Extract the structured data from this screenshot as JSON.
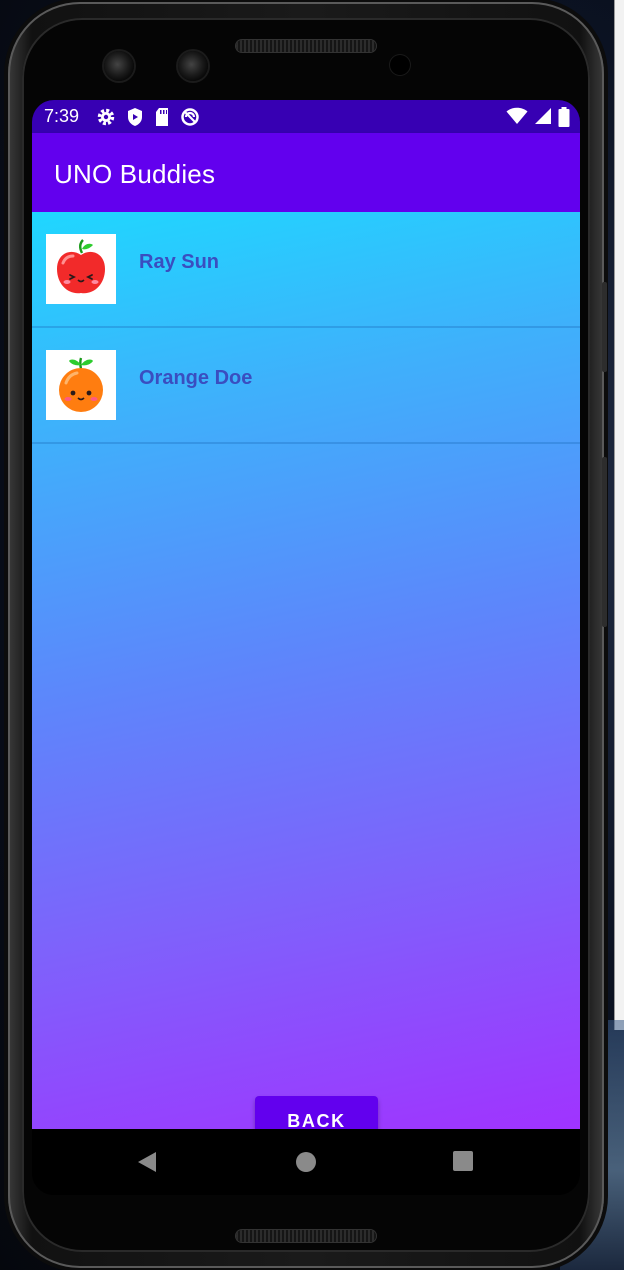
{
  "status_bar": {
    "time": "7:39",
    "left_icons": [
      "gear-icon",
      "shield-icon",
      "sd-card-icon",
      "accessibility-icon"
    ],
    "right_icons": [
      "wifi-icon",
      "signal-icon",
      "battery-icon"
    ]
  },
  "app_bar": {
    "title": "UNO Buddies",
    "color": "#6200ee"
  },
  "buddies": [
    {
      "name": "Ray Sun",
      "avatar": "apple-avatar-icon"
    },
    {
      "name": "Orange Doe",
      "avatar": "orange-avatar-icon"
    }
  ],
  "back_button": {
    "label": "BACK"
  },
  "nav_bar": {
    "buttons": [
      "back-nav-icon",
      "home-nav-icon",
      "recents-nav-icon"
    ]
  },
  "colors": {
    "status_bar": "#3700b3",
    "gradient_top": "#1fd7ff",
    "gradient_bottom": "#a033ff",
    "name_text": "#3a4ec0"
  }
}
